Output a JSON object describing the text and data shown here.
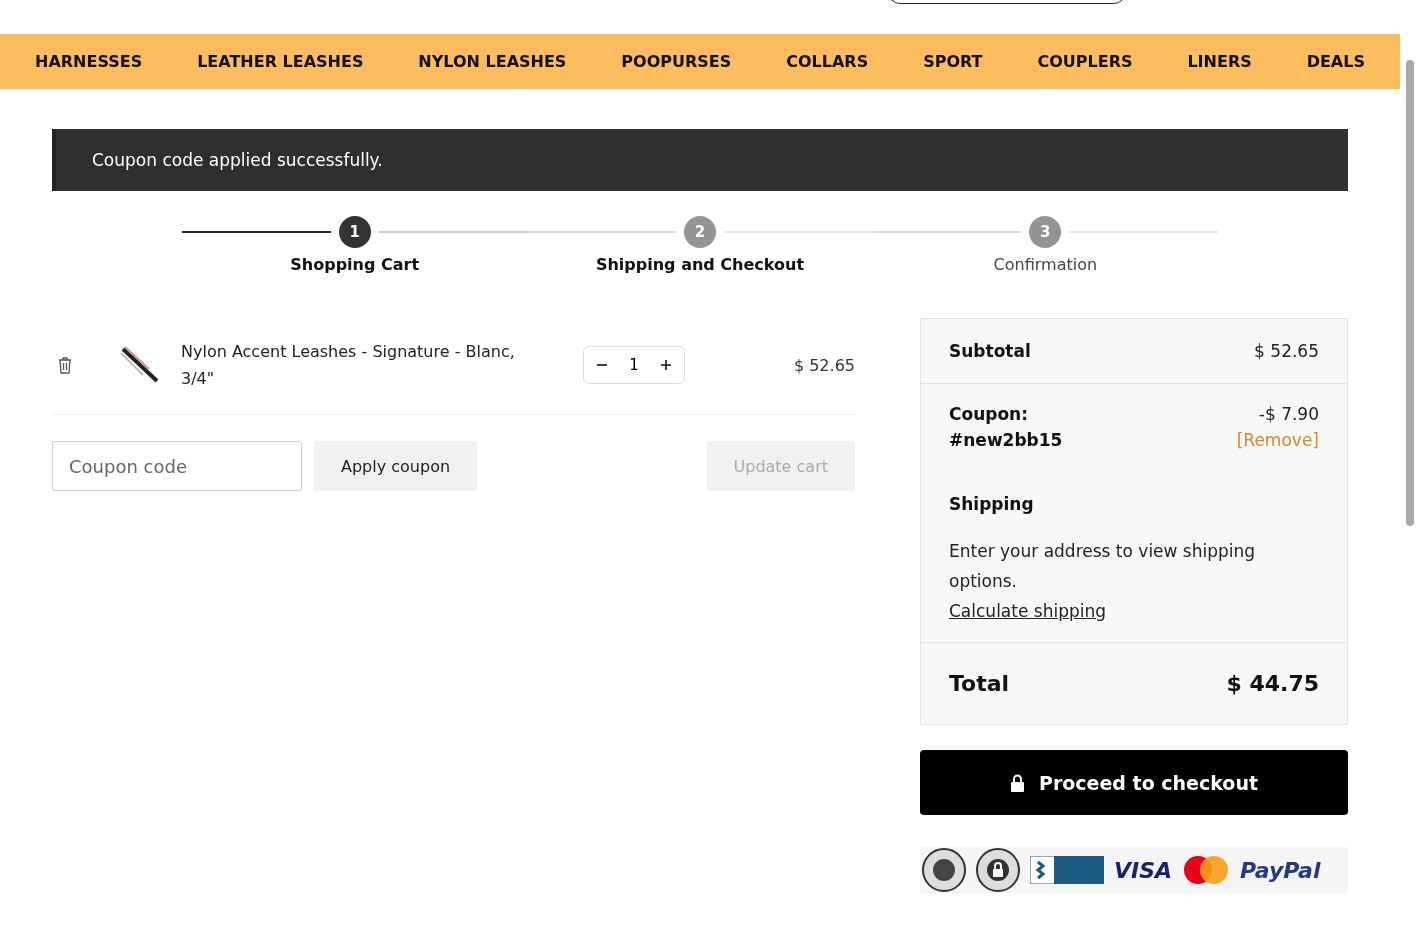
{
  "nav": [
    "HARNESSES",
    "LEATHER LEASHES",
    "NYLON LEASHES",
    "POOPURSES",
    "COLLARS",
    "SPORT",
    "COUPLERS",
    "LINERS",
    "DEALS"
  ],
  "notice": "Coupon code applied successfully.",
  "steps": [
    {
      "number": "1",
      "label": "Shopping Cart",
      "selected": true,
      "bold": true
    },
    {
      "number": "2",
      "label": "Shipping and Checkout",
      "selected": false,
      "bold": true
    },
    {
      "number": "3",
      "label": "Confirmation",
      "selected": false,
      "bold": false
    }
  ],
  "cart": {
    "items": [
      {
        "name": "Nylon Accent Leashes - Signature - Blanc, 3/4\"",
        "quantity": "1",
        "price": "$ 52.65"
      }
    ],
    "coupon": {
      "placeholder": "Coupon code"
    },
    "apply_button": "Apply coupon",
    "update_button": {
      "label": "Update cart",
      "disabled": true
    }
  },
  "summary": {
    "subtotal_label": "Subtotal",
    "subtotal": "$ 52.65",
    "coupon_label": "Coupon:",
    "coupon_code": "#new2bb15",
    "coupon_amount": "-$ 7.90",
    "remove_link": "[Remove]",
    "shipping_label": "Shipping",
    "shipping_text": "Enter your address to view shipping options.",
    "calculate_link": "Calculate shipping",
    "total_label": "Total",
    "total": "$ 44.75"
  },
  "checkout_button": "Proceed to checkout",
  "badges": [
    {
      "kind": "seal"
    },
    {
      "kind": "lock-seal"
    },
    {
      "kind": "bbb"
    },
    {
      "kind": "wordmark",
      "text": "VISA",
      "color": "#1a1f71"
    },
    {
      "kind": "mastercard"
    },
    {
      "kind": "wordmark",
      "text": "PayPal",
      "color": "#253b80"
    }
  ]
}
